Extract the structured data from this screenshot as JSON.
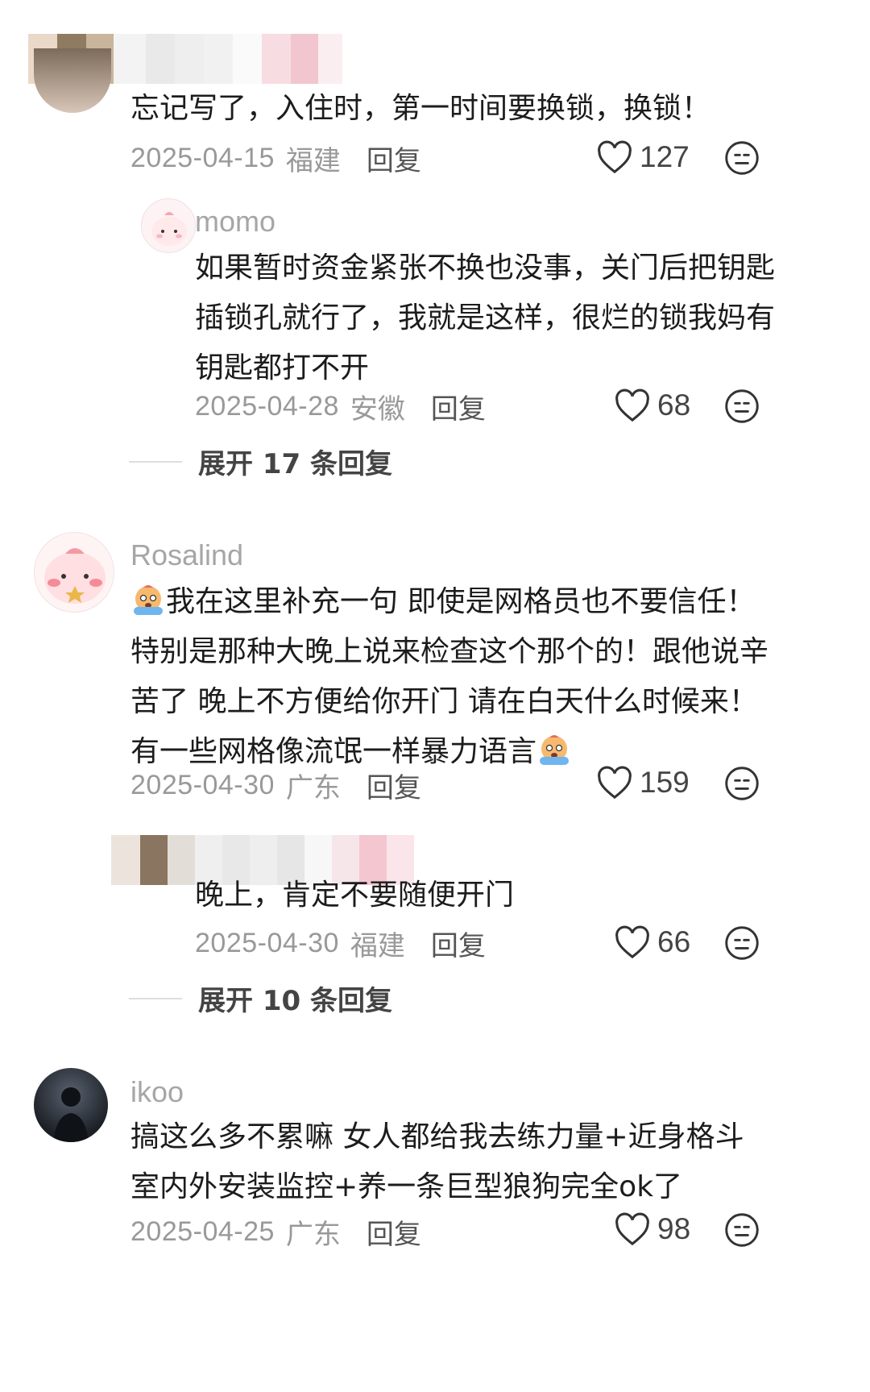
{
  "comments": [
    {
      "username": "",
      "text": "忘记写了，入住时，第一时间要换锁，换锁！",
      "date": "2025-04-15",
      "location": "福建",
      "reply_label": "回复",
      "likes": "127"
    },
    {
      "username": "momo",
      "text": "如果暂时资金紧张不换也没事，关门后把钥匙插锁孔就行了，我就是这样，很烂的锁我妈有钥匙都打不开",
      "lines": [
        "如果暂时资金紧张不换也没事，关门后把钥匙",
        "插锁孔就行了，我就是这样，很烂的锁我妈有",
        "钥匙都打不开"
      ],
      "date": "2025-04-28",
      "location": "安徽",
      "reply_label": "回复",
      "likes": "68",
      "expand_label": "展开 17 条回复"
    },
    {
      "username": "Rosalind",
      "lines": [
        "我在这里补充一句 即使是网格员也不要信任！",
        "特别是那种大晚上说来检查这个那个的！跟他说辛",
        "苦了 晚上不方便给你开门 请在白天什么时候来！",
        "有一些网格像流氓一样暴力语言"
      ],
      "date": "2025-04-30",
      "location": "广东",
      "reply_label": "回复",
      "likes": "159"
    },
    {
      "username": "",
      "text": "晚上，肯定不要随便开门",
      "date": "2025-04-30",
      "location": "福建",
      "reply_label": "回复",
      "likes": "66",
      "expand_label": "展开 10 条回复"
    },
    {
      "username": "ikoo",
      "lines": [
        "搞这么多不累嘛 女人都给我去练力量+近身格斗",
        "室内外安装监控+养一条巨型狼狗完全ok了"
      ],
      "date": "2025-04-25",
      "location": "广东",
      "reply_label": "回复",
      "likes": "98"
    }
  ],
  "icons": {
    "like": "heart-outline-icon",
    "dislike": "neutral-face-icon",
    "emoji": "crying-emoji"
  },
  "colors": {
    "username": "#a6a6a6",
    "meta": "#999999",
    "text": "#1c1c1c"
  }
}
